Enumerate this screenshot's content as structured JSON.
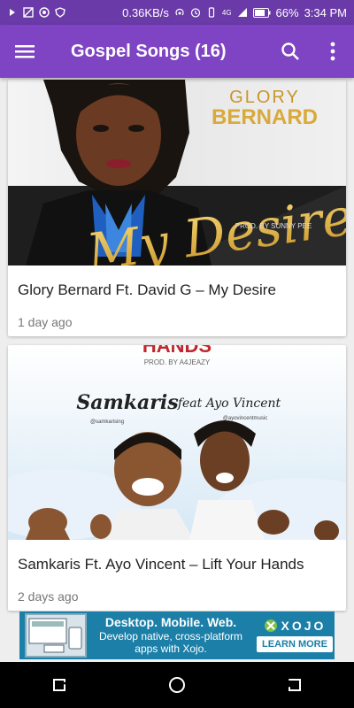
{
  "status_bar": {
    "network_speed": "0.36KB/s",
    "network_type": "4G",
    "battery": "66%",
    "time": "3:34 PM",
    "icons": [
      "notification-icon",
      "no-sim-icon",
      "data-saver-icon",
      "shield-icon",
      "hotspot-icon",
      "alarm-icon",
      "vibrate-icon",
      "signal-icon",
      "battery-icon"
    ]
  },
  "app_bar": {
    "title": "Gospel Songs (16)",
    "menu_icon": "menu-icon",
    "search_icon": "search-icon",
    "more_icon": "more-vert-icon",
    "color": "#7e44c3"
  },
  "posts": [
    {
      "title": "Glory Bernard Ft. David G – My Desire",
      "time": "1 day ago",
      "artwork": {
        "artist_top": "GLORY",
        "artist_bottom": "BERNARD",
        "song_script": "My Desire",
        "producer": "PROD. BY SUNNY PEE"
      }
    },
    {
      "title": "Samkaris Ft. Ayo Vincent – Lift Your Hands",
      "time": "2 days ago",
      "artwork": {
        "banner": "HANDS",
        "producer": "PROD. BY A4JEAZY",
        "artist_left": "Samkaris",
        "artist_left_handle": "@samkarising",
        "feat_artist": "feat Ayo Vincent",
        "feat_handle": "@ayovincentmusic"
      }
    }
  ],
  "ad": {
    "headline": "Desktop. Mobile. Web.",
    "body": "Develop native, cross-platform apps with Xojo.",
    "brand": "XOJO",
    "cta": "LEARN MORE",
    "color": "#1b7fa8"
  },
  "nav_bar": {
    "icons": [
      "recents-icon",
      "home-icon",
      "back-icon"
    ]
  }
}
